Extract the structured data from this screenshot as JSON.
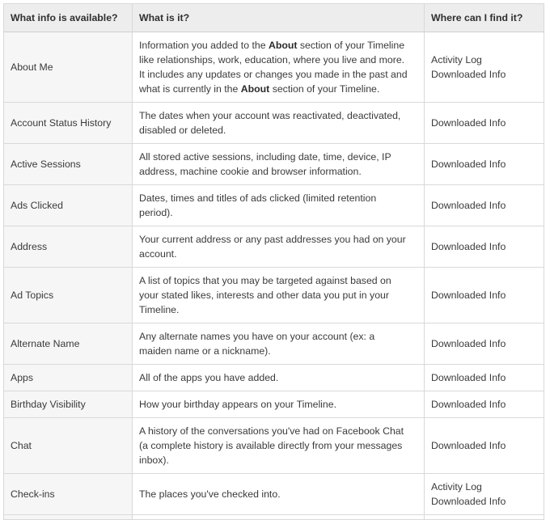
{
  "table": {
    "headers": {
      "col1": "What info is available?",
      "col2": "What is it?",
      "col3": "Where can I find it?"
    },
    "rows": [
      {
        "name": "About Me",
        "desc_pre": "Information you added to the ",
        "desc_bold1": "About",
        "desc_mid": " section of your Timeline like relationships, work, education, where you live and more. It includes any updates or changes you made in the past and what is currently in the ",
        "desc_bold2": "About",
        "desc_post": " section of your Timeline.",
        "where": "Activity Log\nDownloaded Info"
      },
      {
        "name": "Account Status History",
        "desc": "The dates when your account was reactivated, deactivated, disabled or deleted.",
        "where": "Downloaded Info"
      },
      {
        "name": "Active Sessions",
        "desc": "All stored active sessions, including date, time, device, IP address, machine cookie and browser information.",
        "where": "Downloaded Info"
      },
      {
        "name": "Ads Clicked",
        "desc": "Dates, times and titles of ads clicked (limited retention period).",
        "where": "Downloaded Info"
      },
      {
        "name": "Address",
        "desc": "Your current address or any past addresses you had on your account.",
        "where": "Downloaded Info"
      },
      {
        "name": "Ad Topics",
        "desc": "A list of topics that you may be targeted against based on your stated likes, interests and other data you put in your Timeline.",
        "where": "Downloaded Info"
      },
      {
        "name": "Alternate Name",
        "desc": "Any alternate names you have on your account (ex: a maiden name or a nickname).",
        "where": "Downloaded Info"
      },
      {
        "name": "Apps",
        "desc": "All of the apps you have added.",
        "where": "Downloaded Info"
      },
      {
        "name": "Birthday Visibility",
        "desc": "How your birthday appears on your Timeline.",
        "where": "Downloaded Info"
      },
      {
        "name": "Chat",
        "desc": "A history of the conversations you've had on Facebook Chat (a complete history is available directly from your messages inbox).",
        "where": "Downloaded Info"
      },
      {
        "name": "Check-ins",
        "desc": "The places you've checked into.",
        "where": "Activity Log\nDownloaded Info"
      }
    ],
    "colors": {
      "header_background": "#ededed",
      "name_column_background": "#f6f6f6",
      "cell_background": "#ffffff",
      "border": "#d9d9d9",
      "text": "#3a3a3a"
    }
  }
}
